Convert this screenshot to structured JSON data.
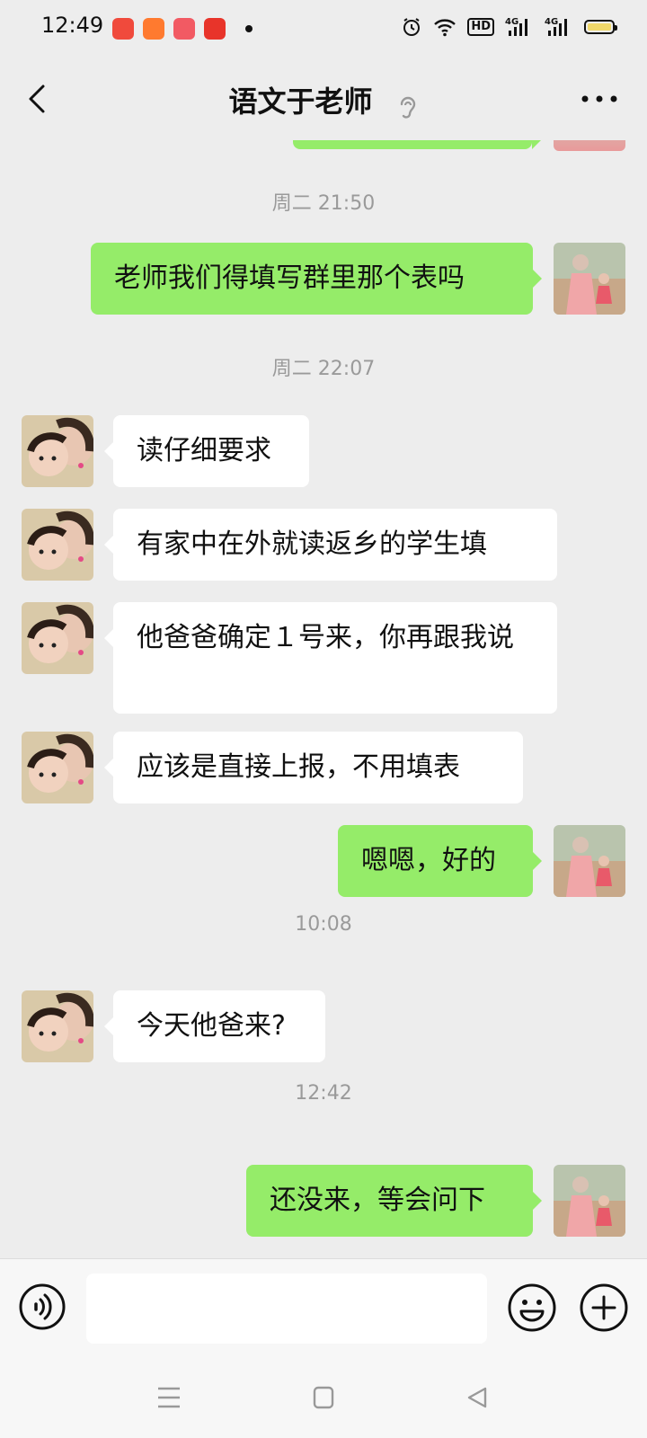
{
  "status_bar": {
    "time": "12:49",
    "app_icons": [
      "kuaishou-icon",
      "app-icon",
      "heart-app-icon",
      "shop-app-icon"
    ],
    "network": "4G",
    "hd": "HD"
  },
  "header": {
    "title": "语文于老师",
    "icons": [
      "back-arrow-icon",
      "ear-icon",
      "more-icon"
    ]
  },
  "messages": [
    {
      "type": "timestamp",
      "text": "周二 21:50"
    },
    {
      "type": "message",
      "side": "out",
      "text": "老师我们得填写群里那个表吗"
    },
    {
      "type": "timestamp",
      "text": "周二 22:07"
    },
    {
      "type": "message",
      "side": "in",
      "text": "读仔细要求"
    },
    {
      "type": "message",
      "side": "in",
      "text": "有家中在外就读返乡的学生填"
    },
    {
      "type": "message",
      "side": "in",
      "text": "他爸爸确定１号来，你再跟我说"
    },
    {
      "type": "message",
      "side": "in",
      "text": "应该是直接上报，不用填表"
    },
    {
      "type": "message",
      "side": "out",
      "text": "嗯嗯，好的"
    },
    {
      "type": "timestamp",
      "text": "10:08"
    },
    {
      "type": "message",
      "side": "in",
      "text": "今天他爸来?"
    },
    {
      "type": "timestamp",
      "text": "12:42"
    },
    {
      "type": "message",
      "side": "out",
      "text": "还没来，等会问下"
    }
  ],
  "input_bar": {
    "icons": [
      "voice-icon",
      "emoji-icon",
      "plus-icon"
    ],
    "text_value": ""
  },
  "colors": {
    "background": "#ededed",
    "outgoing_bubble": "#95ec69",
    "incoming_bubble": "#ffffff"
  }
}
